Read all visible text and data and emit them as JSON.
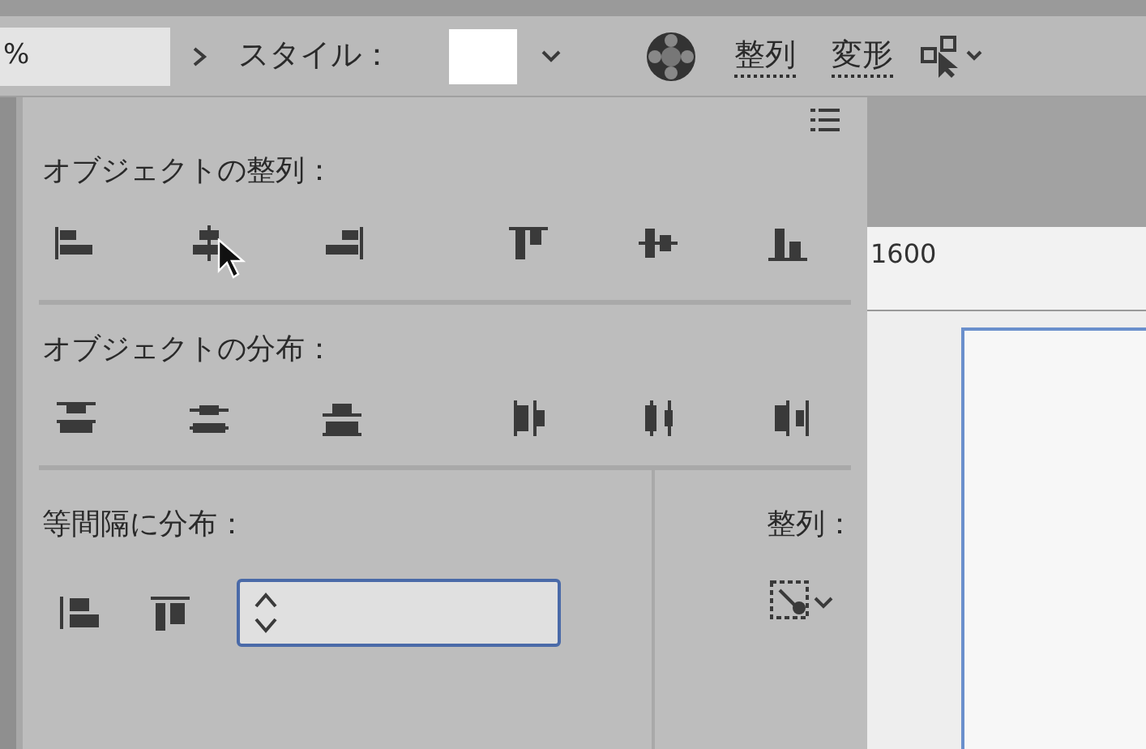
{
  "toolbar": {
    "zoom_field": {
      "value": "%"
    },
    "style_label": "スタイル：",
    "tabs": [
      {
        "label": "整列"
      },
      {
        "label": "変形"
      }
    ]
  },
  "align_panel": {
    "align_title": "オブジェクトの整列：",
    "distribute_title": "オブジェクトの分布：",
    "spacing_title": "等間隔に分布：",
    "align_to_label": "整列："
  },
  "ruler": {
    "label": "1600"
  }
}
